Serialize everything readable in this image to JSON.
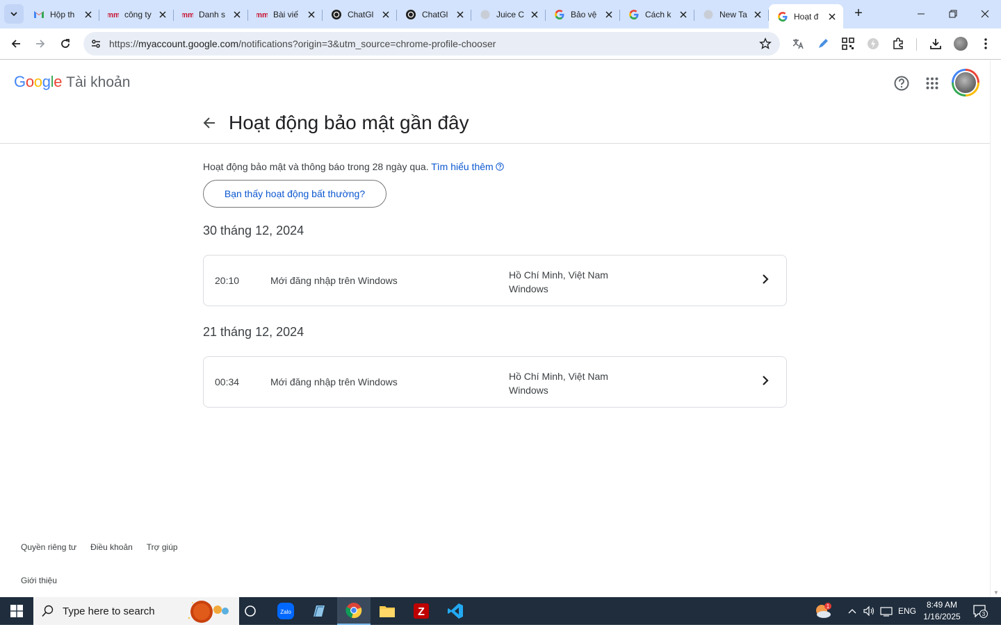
{
  "browser": {
    "tabs": [
      {
        "title": "Hộp th",
        "favicon": "gmail-icon"
      },
      {
        "title": "công ty",
        "favicon": "mm-icon"
      },
      {
        "title": "Danh s",
        "favicon": "mm-icon"
      },
      {
        "title": "Bài viế",
        "favicon": "mm-icon"
      },
      {
        "title": "ChatGl",
        "favicon": "openai-icon"
      },
      {
        "title": "ChatGl",
        "favicon": "openai-icon"
      },
      {
        "title": "Juice C",
        "favicon": "globe-icon"
      },
      {
        "title": "Bảo vệ",
        "favicon": "google-icon"
      },
      {
        "title": "Cách k",
        "favicon": "google-icon"
      },
      {
        "title": "New Ta",
        "favicon": "globe-icon"
      },
      {
        "title": "Hoạt đ",
        "favicon": "google-icon"
      }
    ],
    "address": {
      "scheme": "https://",
      "host": "myaccount.google.com",
      "path": "/notifications?origin=3&utm_source=chrome-profile-chooser"
    }
  },
  "header": {
    "logo_letters": [
      "G",
      "o",
      "o",
      "g",
      "l",
      "e"
    ],
    "logo_colors": [
      "#4285f4",
      "#ea4335",
      "#fbbc04",
      "#4285f4",
      "#34a853",
      "#ea4335"
    ],
    "product": "Tài khoản"
  },
  "main": {
    "title": "Hoạt động bảo mật gần đây",
    "intro": "Hoạt động bảo mật và thông báo trong 28 ngày qua.",
    "learn_more": "Tìm hiểu thêm",
    "unusual_button": "Bạn thấy hoạt động bất thường?",
    "groups": [
      {
        "date": "30 tháng 12, 2024",
        "events": [
          {
            "time": "20:10",
            "description": "Mới đăng nhập trên Windows",
            "location": "Hồ Chí Minh, Việt Nam",
            "device": "Windows"
          }
        ]
      },
      {
        "date": "21 tháng 12, 2024",
        "events": [
          {
            "time": "00:34",
            "description": "Mới đăng nhập trên Windows",
            "location": "Hồ Chí Minh, Việt Nam",
            "device": "Windows"
          }
        ]
      }
    ]
  },
  "footer": {
    "links": [
      "Quyền riêng tư",
      "Điều khoản",
      "Trợ giúp"
    ],
    "about": "Giới thiệu"
  },
  "taskbar": {
    "search_placeholder": "Type here to search",
    "language": "ENG",
    "time": "8:49 AM",
    "date": "1/16/2025",
    "notification_count": "3",
    "widget_badge": "1"
  },
  "colors": {
    "accent": "#0b57d0",
    "tabstrip": "#d3e3fd",
    "taskbar": "#1f2d3d"
  }
}
